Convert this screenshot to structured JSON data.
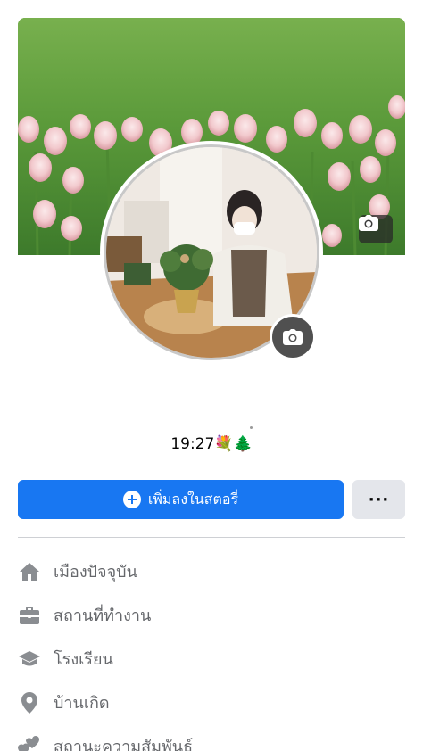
{
  "profile": {
    "bio": "19:27💐🌲"
  },
  "actions": {
    "add_story_label": "เพิ่มลงในสตอรี่",
    "more_label": "···"
  },
  "details": [
    {
      "icon": "home-icon",
      "label": "เมืองปัจจุบัน"
    },
    {
      "icon": "briefcase-icon",
      "label": "สถานที่ทำงาน"
    },
    {
      "icon": "graduation-cap-icon",
      "label": "โรงเรียน"
    },
    {
      "icon": "location-pin-icon",
      "label": "บ้านเกิด"
    },
    {
      "icon": "hearts-icon",
      "label": "สถานะความสัมพันธ์"
    }
  ],
  "colors": {
    "primary": "#1877f2",
    "secondary_button": "#e4e6eb",
    "detail_text": "#65676b",
    "icon": "#8a8d91"
  }
}
